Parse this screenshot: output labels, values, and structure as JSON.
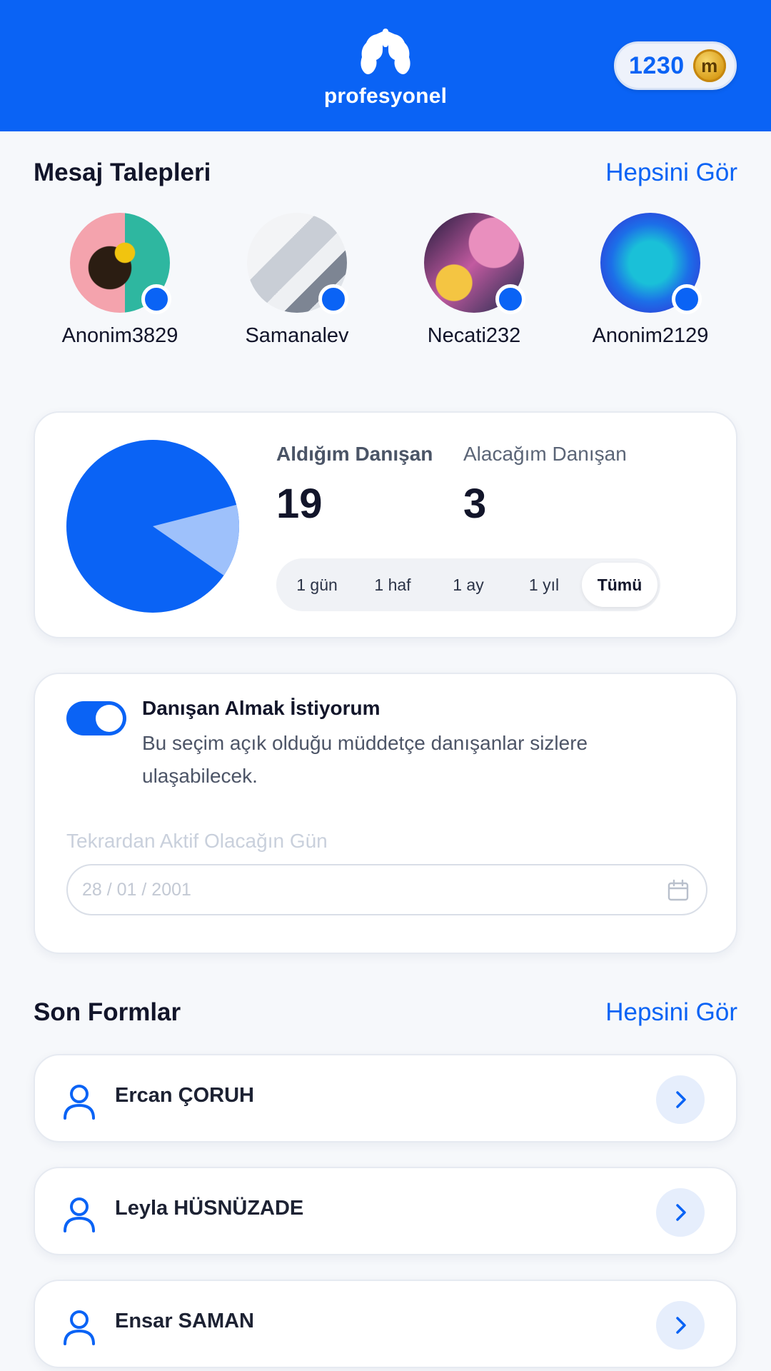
{
  "header": {
    "logo_text": "profesyonel",
    "coins": "1230",
    "coin_symbol": "m"
  },
  "message_requests": {
    "title": "Mesaj Talepleri",
    "see_all": "Hepsini Gör",
    "items": [
      {
        "name": "Anonim3829"
      },
      {
        "name": "Samanalev"
      },
      {
        "name": "Necati232"
      },
      {
        "name": "Anonim2129"
      }
    ]
  },
  "stats": {
    "received_label": "Aldığım Danışan",
    "received_value": "19",
    "upcoming_label": "Alacağım Danışan",
    "upcoming_value": "3",
    "periods": [
      "1 gün",
      "1 haf",
      "1 ay",
      "1 yıl",
      "Tümü"
    ],
    "active_period": "Tümü",
    "pie_colors": {
      "received": "#0a63f5",
      "upcoming": "#9ec1fb"
    }
  },
  "availability": {
    "toggle_on": true,
    "title": "Danışan Almak İstiyorum",
    "description": "Bu seçim açık olduğu müddetçe danışanlar sizlere ulaşabilecek.",
    "date_label": "Tekrardan Aktif Olacağın Gün",
    "date_placeholder": "28 / 01 / 2001"
  },
  "recent_forms": {
    "title": "Son Formlar",
    "see_all": "Hepsini Gör",
    "items": [
      {
        "name": "Ercan ÇORUH"
      },
      {
        "name": "Leyla HÜSNÜZADE"
      },
      {
        "name": "Ensar SAMAN"
      }
    ]
  },
  "colors": {
    "primary": "#0a63f5",
    "background": "#f6f8fb"
  }
}
